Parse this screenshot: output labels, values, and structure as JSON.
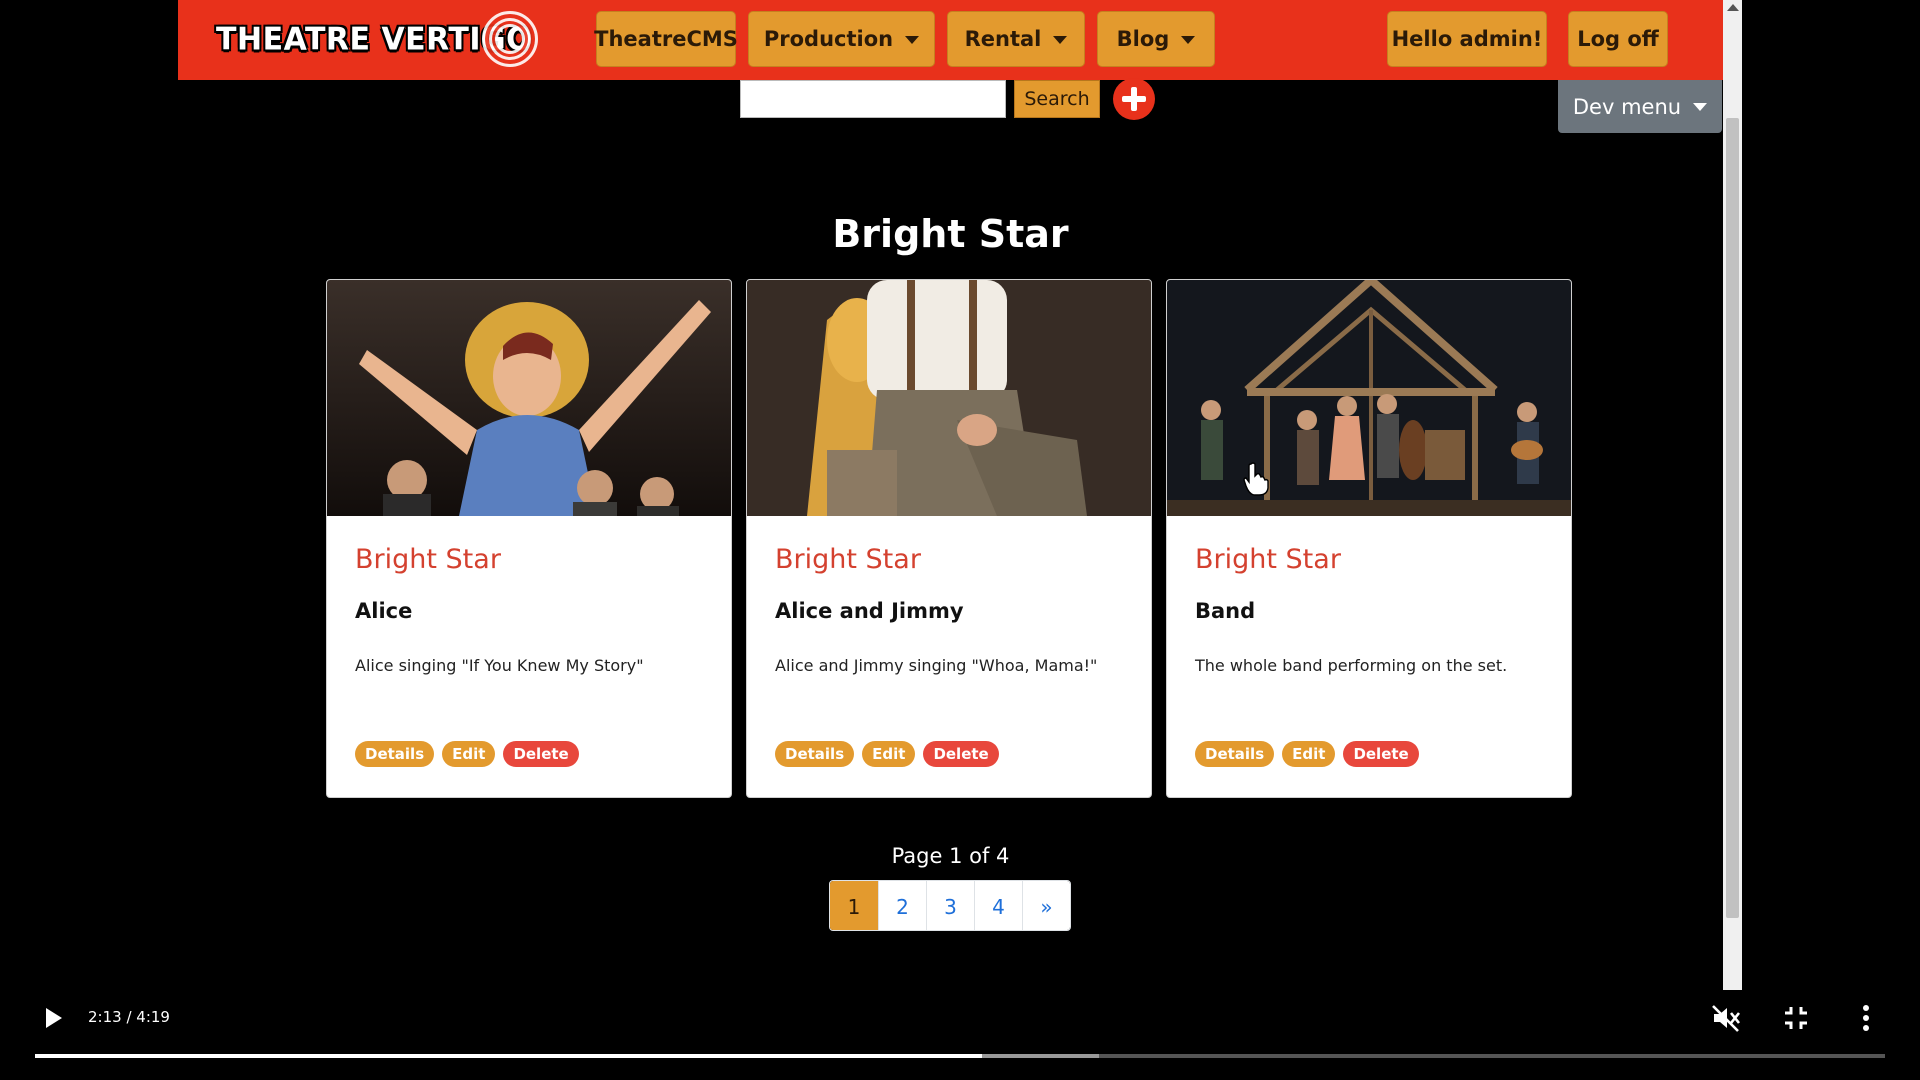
{
  "navbar": {
    "logo_text": "THEATRE VERTIGO",
    "items": [
      {
        "label": "TheatreCMS",
        "dropdown": false
      },
      {
        "label": "Production",
        "dropdown": true
      },
      {
        "label": "Rental",
        "dropdown": true
      },
      {
        "label": "Blog",
        "dropdown": true
      }
    ],
    "greeting": "Hello admin!",
    "logoff": "Log off"
  },
  "search": {
    "value": "",
    "button_label": "Search"
  },
  "add_button_icon": "plus-circle-icon",
  "dev_menu": {
    "label": "Dev menu"
  },
  "page_title": "Bright Star",
  "cards": [
    {
      "title": "Bright Star",
      "subtitle": "Alice",
      "description": "Alice singing \"If You Knew My Story\"",
      "actions": [
        "Details",
        "Edit",
        "Delete"
      ]
    },
    {
      "title": "Bright Star",
      "subtitle": "Alice and Jimmy",
      "description": "Alice and Jimmy singing \"Whoa, Mama!\"",
      "actions": [
        "Details",
        "Edit",
        "Delete"
      ]
    },
    {
      "title": "Bright Star",
      "subtitle": "Band",
      "description": "The whole band performing on the set.",
      "actions": [
        "Details",
        "Edit",
        "Delete"
      ]
    }
  ],
  "pagination": {
    "info": "Page 1 of 4",
    "pages": [
      "1",
      "2",
      "3",
      "4",
      "»"
    ],
    "current": "1"
  },
  "colors": {
    "nav_red": "#e8311b",
    "nav_button": "#e39a2e",
    "card_title": "#d4412f",
    "delete_red": "#e8473c",
    "dev_menu_gray": "#6c757d"
  },
  "player": {
    "time": "2:13 / 4:19",
    "progress_fraction": 0.512,
    "buffered_fraction": 0.575,
    "icons": [
      "play-icon",
      "mute-icon",
      "exit-fullscreen-icon",
      "more-vert-icon"
    ]
  }
}
